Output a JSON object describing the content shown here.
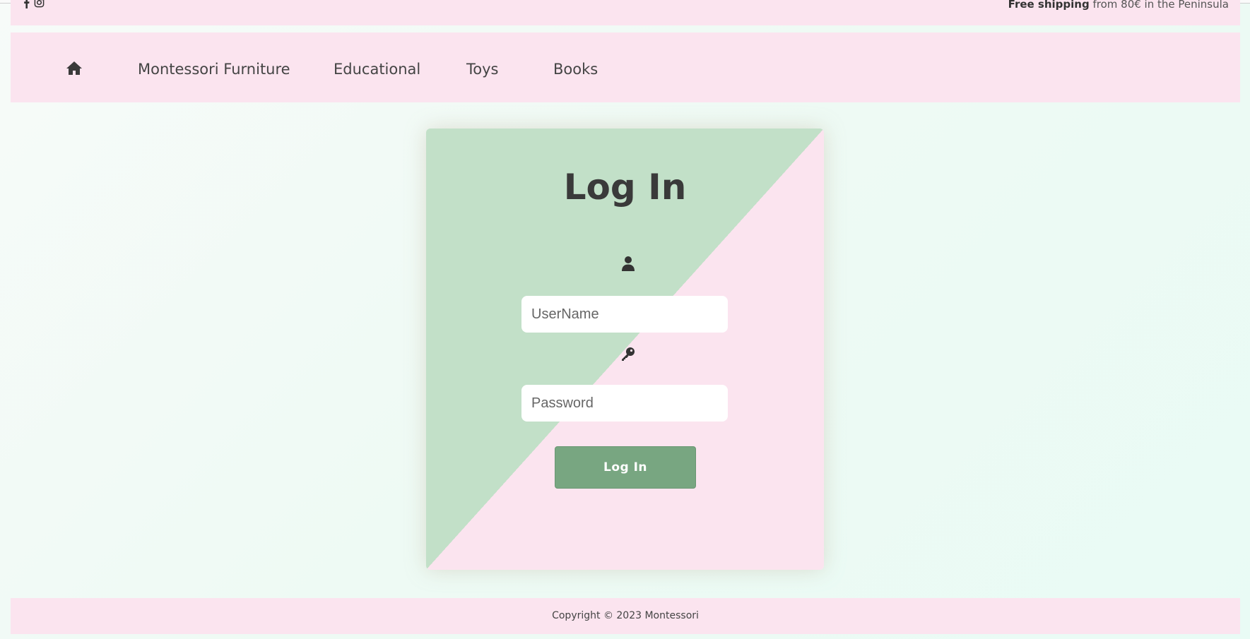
{
  "topbar": {
    "shipping_bold": "Free shipping",
    "shipping_rest": " from 80€ in the Peninsula"
  },
  "nav": {
    "items": [
      {
        "label": "Montessori Furniture"
      },
      {
        "label": "Educational"
      },
      {
        "label": "Toys"
      },
      {
        "label": "Books"
      }
    ]
  },
  "login": {
    "title": "Log In",
    "username_placeholder": "UserName",
    "password_placeholder": "Password",
    "button_label": "Log In"
  },
  "footer": {
    "copyright": "Copyright © 2023 Montessori"
  },
  "colors": {
    "pink": "#fbe4ef",
    "green": "#c2e0c8",
    "button": "#78a681"
  },
  "icons": [
    "facebook-icon",
    "instagram-icon",
    "home-icon",
    "user-icon",
    "key-icon"
  ]
}
